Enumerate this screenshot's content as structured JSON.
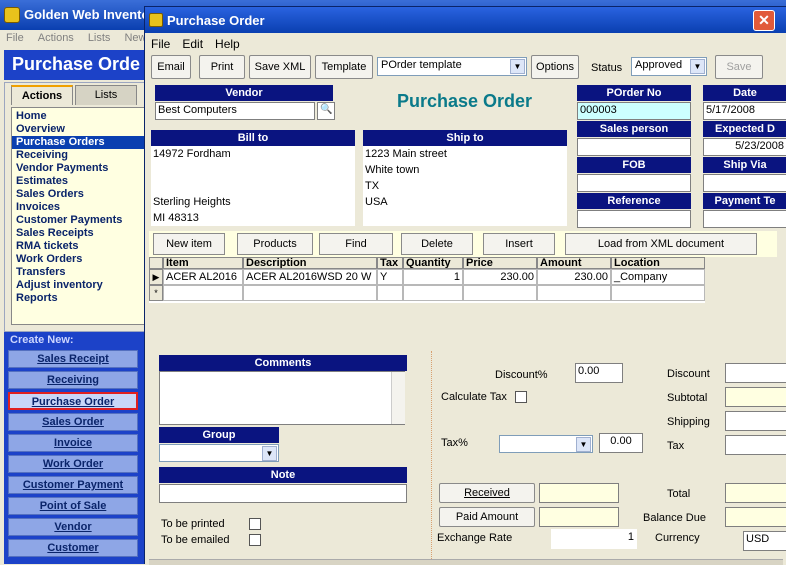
{
  "bg": {
    "title": "Golden Web Invento",
    "menu": [
      "File",
      "Actions",
      "Lists",
      "New"
    ],
    "heading": "Purchase Orde",
    "tabs": [
      "Actions",
      "Lists"
    ],
    "nav": [
      "Home",
      "Overview",
      "Purchase Orders",
      "Receiving",
      "Vendor Payments",
      "Estimates",
      "Sales Orders",
      "Invoices",
      "Customer Payments",
      "Sales Receipts",
      "RMA tickets",
      "Work Orders",
      "Transfers",
      "Adjust inventory",
      "Reports"
    ],
    "create_title": "Create New:",
    "create": [
      "Sales Receipt",
      "Receiving",
      "Purchase Order",
      "Sales Order",
      "Invoice",
      "Work Order",
      "Customer Payment",
      "Point of Sale",
      "Vendor",
      "Customer"
    ]
  },
  "dlg": {
    "title": "Purchase Order",
    "close": "✕",
    "menu": [
      "File",
      "Edit",
      "Help"
    ],
    "toolbar": {
      "email": "Email",
      "print": "Print",
      "save_xml": "Save XML",
      "template": "Template",
      "template_value": "POrder template",
      "options": "Options",
      "status_label": "Status",
      "status_value": "Approved",
      "save": "Save"
    },
    "vendor_label": "Vendor",
    "vendor_value": "Best Computers",
    "big_title": "Purchase Order",
    "porder_label": "POrder No",
    "porder_value": "000003",
    "date_label": "Date",
    "date_value": "5/17/2008",
    "bill_to_label": "Bill to",
    "bill_to": [
      "14972 Fordham",
      "",
      "",
      "Sterling Heights",
      "MI  48313"
    ],
    "ship_to_label": "Ship to",
    "ship_to": [
      "1223 Main street",
      "White town",
      "TX",
      "USA"
    ],
    "salesperson_label": "Sales person",
    "expected_label": "Expected D",
    "expected_value": "5/23/2008",
    "fob_label": "FOB",
    "shipvia_label": "Ship Via",
    "reference_label": "Reference",
    "payment_label": "Payment Te",
    "itembar": [
      "New item",
      "Products",
      "Find",
      "Delete",
      "Insert",
      "Load from XML document"
    ],
    "grid": {
      "headers": [
        "Item",
        "Description",
        "Tax",
        "Quantity",
        "Price",
        "Amount",
        "Location"
      ],
      "row": [
        "ACER AL2016",
        "ACER AL2016WSD 20 W",
        "Y",
        "1",
        "230.00",
        "230.00",
        "_Company"
      ],
      "row_marker": "▶",
      "new_marker": "*"
    },
    "comments_label": "Comments",
    "group_label": "Group",
    "note_label": "Note",
    "printed_label": "To be printed",
    "emailed_label": "To be emailed",
    "discount_pct_label": "Discount%",
    "discount_pct_value": "0.00",
    "calc_tax_label": "Calculate Tax",
    "tax_pct_label": "Tax%",
    "tax_pct_value": "0.00",
    "received_btn": "Received",
    "paid_btn": "Paid Amount",
    "exchange_label": "Exchange Rate",
    "exchange_value": "1",
    "discount_label": "Discount",
    "subtotal_label": "Subtotal",
    "shipping_label": "Shipping",
    "tax_label": "Tax",
    "total_label": "Total",
    "balance_label": "Balance Due",
    "currency_label": "Currency",
    "currency_value": "USD"
  }
}
